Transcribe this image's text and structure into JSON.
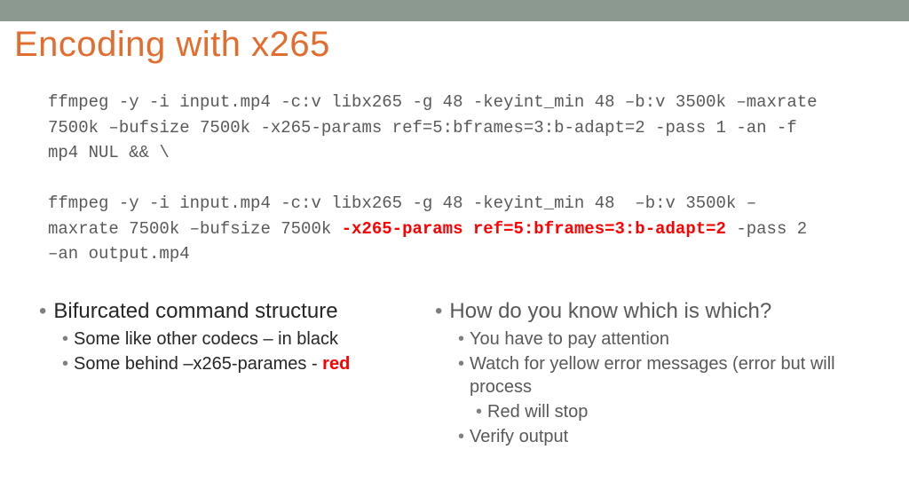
{
  "title": "Encoding with x265",
  "code": {
    "pass1_a": "ffmpeg -y -i input.mp4 -c:v libx265 -g 48 -keyint_min 48 –b:v 3500k –maxrate",
    "pass1_b": "7500k –bufsize 7500k -x265-params ref=5:bframes=3:b-adapt=2 -pass 1 -an -f",
    "pass1_c": "mp4 NUL && \\",
    "pass2_a": "ffmpeg -y -i input.mp4 -c:v libx265 -g 48 -keyint_min 48  –b:v 3500k –",
    "pass2_b_pre": "maxrate 7500k –bufsize 7500k ",
    "pass2_b_red": "-x265-params ref=5:bframes=3:b-adapt=2",
    "pass2_b_post": " -pass 2",
    "pass2_c": "–an output.mp4"
  },
  "left": {
    "h": "Bifurcated command structure",
    "s1": "Some like other codecs – in black",
    "s2_pre": "Some behind –x265-parames - ",
    "s2_red": "red"
  },
  "right": {
    "h": "How do you know which is which?",
    "s1": "You have to pay attention",
    "s2": "Watch for yellow error messages (error but will process",
    "s2a": "Red will stop",
    "s3": "Verify output"
  }
}
